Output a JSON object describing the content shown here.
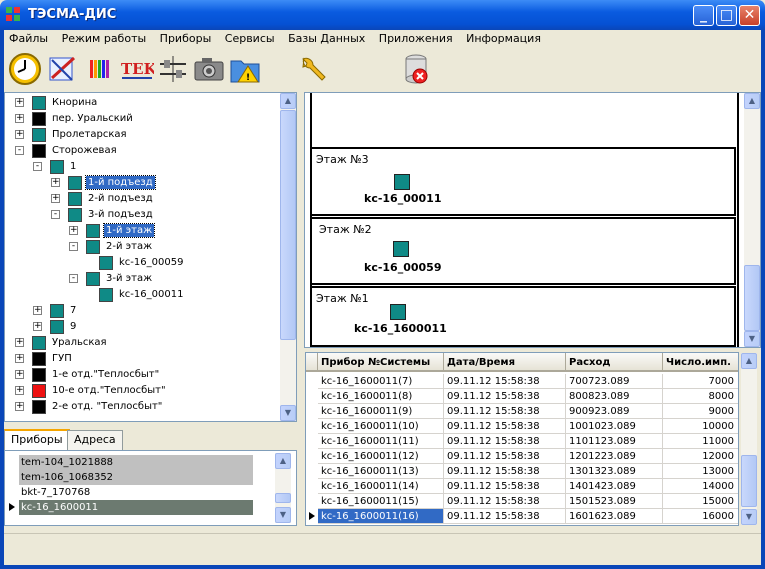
{
  "window": {
    "title": "ТЭСМА-ДИС"
  },
  "menu": [
    "Файлы",
    "Режим работы",
    "Приборы",
    "Сервисы",
    "Базы Данных",
    "Приложения",
    "Информация"
  ],
  "toolbar": [
    {
      "name": "clock-icon"
    },
    {
      "name": "schema-edit-icon"
    },
    {
      "name": "color-bars-icon"
    },
    {
      "name": "tek-icon",
      "text": "TEK"
    },
    {
      "name": "network-icon"
    },
    {
      "name": "camera-icon"
    },
    {
      "name": "folder-warning-icon"
    },
    {
      "name": "wrench-icon"
    },
    {
      "name": "database-delete-icon"
    }
  ],
  "tree": [
    {
      "label": "Кнорина",
      "level": 0,
      "color": "#0f8a86",
      "exp": "+"
    },
    {
      "label": "пер. Уральский",
      "level": 0,
      "color": "#000000",
      "exp": "+"
    },
    {
      "label": "Пролетарская",
      "level": 0,
      "color": "#0f8a86",
      "exp": "+"
    },
    {
      "label": "Сторожевая",
      "level": 0,
      "color": "#000000",
      "exp": "-"
    },
    {
      "label": "1",
      "level": 1,
      "color": "#0f8a86",
      "exp": "-"
    },
    {
      "label": "1-й подъезд",
      "level": 2,
      "color": "#0f8a86",
      "exp": "+",
      "selected": true
    },
    {
      "label": "2-й подъезд",
      "level": 2,
      "color": "#0f8a86",
      "exp": "+"
    },
    {
      "label": "3-й подъезд",
      "level": 2,
      "color": "#0f8a86",
      "exp": "-"
    },
    {
      "label": "1-й этаж",
      "level": 3,
      "color": "#0f8a86",
      "exp": "+",
      "selected": true
    },
    {
      "label": "2-й этаж",
      "level": 3,
      "color": "#0f8a86",
      "exp": "-"
    },
    {
      "label": "kc-16_00059",
      "level": 4,
      "color": "#0f8a86",
      "exp": ""
    },
    {
      "label": "3-й этаж",
      "level": 3,
      "color": "#0f8a86",
      "exp": "-"
    },
    {
      "label": "kc-16_00011",
      "level": 4,
      "color": "#0f8a86",
      "exp": ""
    },
    {
      "label": "7",
      "level": 1,
      "color": "#0f8a86",
      "exp": "+"
    },
    {
      "label": "9",
      "level": 1,
      "color": "#0f8a86",
      "exp": "+"
    },
    {
      "label": "Уральская",
      "level": 0,
      "color": "#0f8a86",
      "exp": "+"
    },
    {
      "label": "ГУП",
      "level": 0,
      "color": "#000000",
      "exp": "+"
    },
    {
      "label": "1-е отд.\"Теплосбыт\"",
      "level": 0,
      "color": "#000000",
      "exp": "+"
    },
    {
      "label": "10-е отд.\"Теплосбыт\"",
      "level": 0,
      "color": "#ee1111",
      "exp": "+"
    },
    {
      "label": "2-е отд. \"Теплосбыт\"",
      "level": 0,
      "color": "#000000",
      "exp": "+"
    }
  ],
  "tabs": [
    "Приборы",
    "Адреса"
  ],
  "devices": [
    {
      "label": "tem-104_1021888",
      "bg": "#c0c0c0"
    },
    {
      "label": "tem-106_1068352",
      "bg": "#c0c0c0"
    },
    {
      "label": "bkt-7_170768",
      "bg": "#ffffff"
    },
    {
      "label": "kc-16_1600011",
      "bg": "#6c7a70",
      "current": true
    }
  ],
  "floors": [
    {
      "label": "Этаж №3",
      "device": "kc-16_00011"
    },
    {
      "label": "Этаж №2",
      "device": "kc-16_00059"
    },
    {
      "label": "Этаж №1",
      "device": "kc-16_1600011"
    }
  ],
  "grid": {
    "columns": [
      "Прибор №Системы",
      "Дата/Время",
      "Расход",
      "Число.имп."
    ],
    "rows": [
      [
        "kc-16_1600011(7)",
        "09.11.12 15:58:38",
        "700723.089",
        "7000"
      ],
      [
        "kc-16_1600011(8)",
        "09.11.12 15:58:38",
        "800823.089",
        "8000"
      ],
      [
        "kc-16_1600011(9)",
        "09.11.12 15:58:38",
        "900923.089",
        "9000"
      ],
      [
        "kc-16_1600011(10)",
        "09.11.12 15:58:38",
        "1001023.089",
        "10000"
      ],
      [
        "kc-16_1600011(11)",
        "09.11.12 15:58:38",
        "1101123.089",
        "11000"
      ],
      [
        "kc-16_1600011(12)",
        "09.11.12 15:58:38",
        "1201223.089",
        "12000"
      ],
      [
        "kc-16_1600011(13)",
        "09.11.12 15:58:38",
        "1301323.089",
        "13000"
      ],
      [
        "kc-16_1600011(14)",
        "09.11.12 15:58:38",
        "1401423.089",
        "14000"
      ],
      [
        "kc-16_1600011(15)",
        "09.11.12 15:58:38",
        "1501523.089",
        "15000"
      ],
      [
        "kc-16_1600011(16)",
        "09.11.12 15:58:38",
        "1601623.089",
        "16000"
      ]
    ],
    "current_row": 9
  }
}
